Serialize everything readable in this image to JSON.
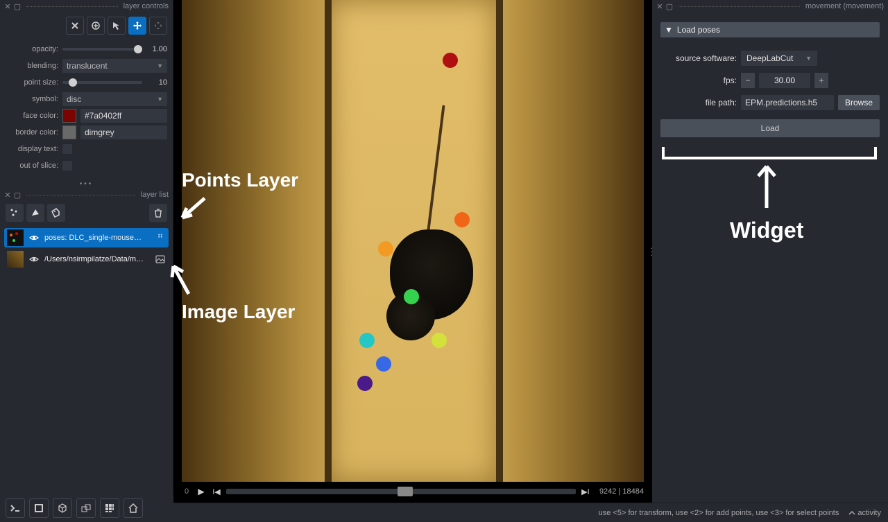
{
  "left_panel": {
    "title": "layer controls",
    "opacity_label": "opacity:",
    "opacity_val": "1.00",
    "blending_label": "blending:",
    "blending_val": "translucent",
    "point_size_label": "point size:",
    "point_size_val": "10",
    "symbol_label": "symbol:",
    "symbol_val": "disc",
    "face_color_label": "face color:",
    "face_color_hex": "#7a0402ff",
    "border_color_label": "border color:",
    "border_color_val": "dimgrey",
    "display_text_label": "display text:",
    "out_of_slice_label": "out of slice:"
  },
  "layerlist": {
    "title": "layer list",
    "items": [
      {
        "label": "poses: DLC_single-mouse…"
      },
      {
        "label": "/Users/nsirmpilatze/Data/m…"
      }
    ]
  },
  "playback": {
    "dim": "0",
    "frame": "9242",
    "total": "18484"
  },
  "right": {
    "title": "movement (movement)",
    "section": "Load poses",
    "source_label": "source software:",
    "source_val": "DeepLabCut",
    "fps_label": "fps:",
    "fps_val": "30.00",
    "filepath_label": "file path:",
    "filepath_val": "EPM.predictions.h5",
    "browse": "Browse",
    "load": "Load"
  },
  "status": {
    "hint": "use <5> for transform, use <2> for add points, use <3> for select points",
    "activity": "activity"
  },
  "annotations": {
    "points": "Points Layer",
    "image": "Image Layer",
    "widget": "Widget"
  }
}
